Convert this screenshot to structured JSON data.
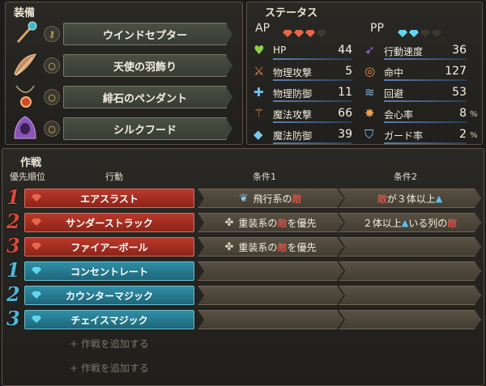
{
  "equipment": {
    "title": "装備",
    "items": [
      {
        "name": "ウインドセプター",
        "icon": "scepter-icon",
        "slot_icon": "key-icon"
      },
      {
        "name": "天使の羽飾り",
        "icon": "feather-icon",
        "slot_icon": "ring-icon"
      },
      {
        "name": "緋石のペンダント",
        "icon": "pendant-icon",
        "slot_icon": "ring-icon"
      },
      {
        "name": "シルクフード",
        "icon": "hood-icon",
        "slot_icon": "ring-icon"
      }
    ]
  },
  "status": {
    "title": "ステータス",
    "ap_label": "AP",
    "ap_gems_filled": 3,
    "ap_gems_total": 4,
    "pp_label": "PP",
    "pp_gems_filled": 2,
    "pp_gems_total": 4,
    "left": [
      {
        "label": "HP",
        "value": "44",
        "icon": "heart-icon"
      },
      {
        "label": "物理攻撃",
        "value": "5",
        "icon": "sword-icon"
      },
      {
        "label": "物理防御",
        "value": "11",
        "icon": "armor-icon"
      },
      {
        "label": "魔法攻撃",
        "value": "66",
        "icon": "wand-icon"
      },
      {
        "label": "魔法防御",
        "value": "39",
        "icon": "magic-shield-icon"
      }
    ],
    "right": [
      {
        "label": "行動速度",
        "value": "36",
        "icon": "speed-icon",
        "unit": ""
      },
      {
        "label": "命中",
        "value": "127",
        "icon": "target-icon",
        "unit": ""
      },
      {
        "label": "回避",
        "value": "53",
        "icon": "evade-icon",
        "unit": ""
      },
      {
        "label": "会心率",
        "value": "8",
        "icon": "critical-icon",
        "unit": "%"
      },
      {
        "label": "ガード率",
        "value": "2",
        "icon": "guard-icon",
        "unit": "%"
      }
    ]
  },
  "tactics": {
    "title": "作戦",
    "headers": {
      "priority": "優先順位",
      "action": "行動",
      "cond1": "条件1",
      "cond2": "条件2"
    },
    "rows": [
      {
        "num": "1",
        "type": "red",
        "action": "エアスラスト",
        "c1_icon": "wing-icon",
        "c1": [
          {
            "t": "飛行系の"
          },
          {
            "t": "敵",
            "red": true
          }
        ],
        "c2": [
          {
            "t": "敵",
            "red": true
          },
          {
            "t": "が３体以上"
          },
          {
            "t": "▲",
            "tri": true
          }
        ]
      },
      {
        "num": "2",
        "type": "red",
        "action": "サンダーストラック",
        "c1_icon": "armor-type-icon",
        "c1": [
          {
            "t": "重装系の"
          },
          {
            "t": "敵",
            "red": true
          },
          {
            "t": "を優先"
          }
        ],
        "c2": [
          {
            "t": "２体以上"
          },
          {
            "t": "▲",
            "tri": true
          },
          {
            "t": "いる列の"
          },
          {
            "t": "敵",
            "red": true
          }
        ]
      },
      {
        "num": "3",
        "type": "red",
        "action": "ファイアーボール",
        "c1_icon": "armor-type-icon",
        "c1": [
          {
            "t": "重装系の"
          },
          {
            "t": "敵",
            "red": true
          },
          {
            "t": "を優先"
          }
        ],
        "c2": []
      },
      {
        "num": "1",
        "type": "blu",
        "action": "コンセントレート",
        "c1": [],
        "c2": []
      },
      {
        "num": "2",
        "type": "blu",
        "action": "カウンターマジック",
        "c1": [],
        "c2": []
      },
      {
        "num": "3",
        "type": "blu",
        "action": "チェイスマジック",
        "c1": [],
        "c2": []
      }
    ],
    "add_label_1": "+ 作戦を追加する",
    "add_label_2": "+ 作戦を追加する"
  },
  "colors": {
    "ap_gem": "#e8674a",
    "pp_gem": "#62d6f0",
    "attack": "#b9392b",
    "support": "#2f8fa6"
  }
}
